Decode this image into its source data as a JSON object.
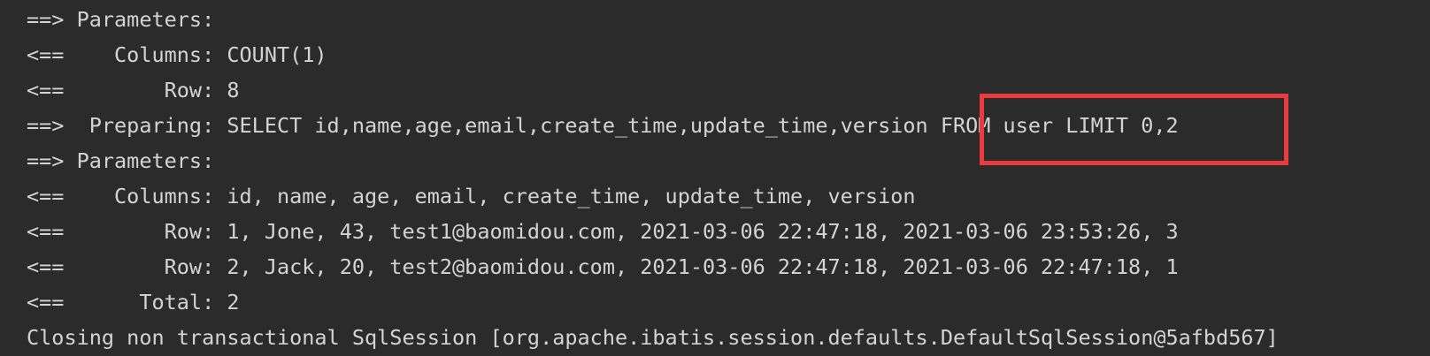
{
  "console": {
    "lines": [
      "==> Parameters: ",
      "<==    Columns: COUNT(1)",
      "<==        Row: 8",
      "==>  Preparing: SELECT id,name,age,email,create_time,update_time,version FROM user LIMIT 0,2",
      "==> Parameters: ",
      "<==    Columns: id, name, age, email, create_time, update_time, version",
      "<==        Row: 1, Jone, 43, test1@baomidou.com, 2021-03-06 22:47:18, 2021-03-06 23:53:26, 3",
      "<==        Row: 2, Jack, 20, test2@baomidou.com, 2021-03-06 22:47:18, 2021-03-06 22:47:18, 1",
      "<==      Total: 2",
      "Closing non transactional SqlSession [org.apache.ibatis.session.defaults.DefaultSqlSession@5afbd567]"
    ],
    "text_color": "#d4d4d4",
    "background_color": "#2b2b2b",
    "highlight_color": "#ec3b3e"
  }
}
